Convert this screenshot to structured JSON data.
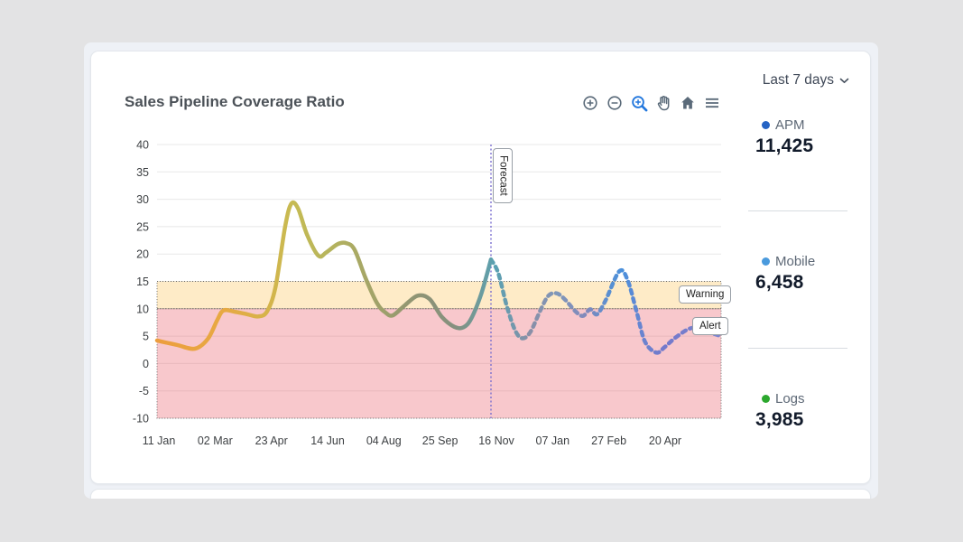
{
  "header": {
    "title": "Sales Pipeline Coverage Ratio"
  },
  "toolbar": {
    "buttons": [
      {
        "name": "zoom-in"
      },
      {
        "name": "zoom-out"
      },
      {
        "name": "box-zoom",
        "active": true
      },
      {
        "name": "pan"
      },
      {
        "name": "home"
      },
      {
        "name": "menu"
      }
    ],
    "active_color": "#2277dd",
    "icon_color": "#5a6a79"
  },
  "sidebar": {
    "range_label": "Last 7 days",
    "items": [
      {
        "label": "APM",
        "value": "11,425",
        "color": "#2563c4"
      },
      {
        "label": "Mobile",
        "value": "6,458",
        "color": "#4a9add"
      },
      {
        "label": "Logs",
        "value": "3,985",
        "color": "#2ca82e"
      }
    ]
  },
  "chart_data": {
    "type": "line",
    "title": "Sales Pipeline Coverage Ratio",
    "xlabel": "",
    "ylabel": "",
    "x_tick_labels": [
      "11 Jan",
      "02 Mar",
      "23 Apr",
      "14 Jun",
      "04 Aug",
      "25 Sep",
      "16 Nov",
      "07 Jan",
      "27 Feb",
      "20 Apr"
    ],
    "y_ticks": [
      40,
      35,
      30,
      25,
      20,
      15,
      10,
      5,
      0,
      -5,
      -10
    ],
    "ylim": [
      -10,
      40
    ],
    "grid": true,
    "legend_position": "right-panel",
    "bands": [
      {
        "name": "warning",
        "label": "Warning",
        "from": 10,
        "to": 15,
        "fill": "rgba(252,208,122,0.42)",
        "border": "#6b6b6b"
      },
      {
        "name": "alert",
        "label": "Alert",
        "from": -10,
        "to": 10,
        "fill": "rgba(236,98,110,0.35)",
        "border": "#6b6b6b"
      }
    ],
    "forecast_divider": {
      "label": "Forecast",
      "u": 0.592,
      "color": "#7b6fd0"
    },
    "series": [
      {
        "name": "history",
        "style": "solid",
        "points": [
          [
            0,
            4.2
          ],
          [
            0.035,
            3.4
          ],
          [
            0.067,
            2.7
          ],
          [
            0.09,
            4.5
          ],
          [
            0.107,
            8.0
          ],
          [
            0.118,
            9.7
          ],
          [
            0.14,
            9.4
          ],
          [
            0.16,
            9.0
          ],
          [
            0.179,
            8.6
          ],
          [
            0.195,
            9.5
          ],
          [
            0.21,
            14.0
          ],
          [
            0.227,
            25.0
          ],
          [
            0.238,
            29.2
          ],
          [
            0.25,
            28.3
          ],
          [
            0.266,
            23.5
          ],
          [
            0.286,
            19.7
          ],
          [
            0.3,
            20.3
          ],
          [
            0.32,
            21.8
          ],
          [
            0.335,
            22.0
          ],
          [
            0.35,
            20.8
          ],
          [
            0.37,
            15.5
          ],
          [
            0.39,
            11.0
          ],
          [
            0.405,
            9.3
          ],
          [
            0.418,
            8.8
          ],
          [
            0.44,
            10.7
          ],
          [
            0.462,
            12.4
          ],
          [
            0.483,
            11.8
          ],
          [
            0.505,
            8.5
          ],
          [
            0.527,
            6.7
          ],
          [
            0.543,
            6.6
          ],
          [
            0.557,
            8.2
          ],
          [
            0.575,
            12.8
          ],
          [
            0.592,
            19.0
          ]
        ]
      },
      {
        "name": "forecast",
        "style": "dashed",
        "points": [
          [
            0.592,
            19.0
          ],
          [
            0.605,
            16.5
          ],
          [
            0.62,
            10.5
          ],
          [
            0.635,
            6.0
          ],
          [
            0.648,
            4.6
          ],
          [
            0.662,
            5.8
          ],
          [
            0.68,
            9.8
          ],
          [
            0.694,
            12.4
          ],
          [
            0.709,
            12.8
          ],
          [
            0.724,
            11.6
          ],
          [
            0.742,
            9.5
          ],
          [
            0.755,
            8.7
          ],
          [
            0.768,
            9.9
          ],
          [
            0.78,
            9.0
          ],
          [
            0.795,
            11.5
          ],
          [
            0.82,
            16.9
          ],
          [
            0.835,
            15.0
          ],
          [
            0.85,
            9.5
          ],
          [
            0.865,
            4.0
          ],
          [
            0.885,
            2.0
          ],
          [
            0.9,
            3.0
          ],
          [
            0.92,
            4.8
          ],
          [
            0.945,
            6.4
          ],
          [
            0.965,
            6.3
          ],
          [
            0.985,
            5.5
          ],
          [
            1,
            5.0
          ]
        ]
      }
    ],
    "gradient_stops": [
      [
        0,
        "#ec9e3e"
      ],
      [
        0.12,
        "#e7a943"
      ],
      [
        0.2,
        "#d4b44b"
      ],
      [
        0.24,
        "#c6bb53"
      ],
      [
        0.3,
        "#b7b55c"
      ],
      [
        0.38,
        "#a3a468"
      ],
      [
        0.46,
        "#8f9474"
      ],
      [
        0.53,
        "#85907f"
      ],
      [
        0.57,
        "#6e9b9b"
      ],
      [
        0.6,
        "#58a1b3"
      ],
      [
        0.66,
        "#8a8fa6"
      ],
      [
        0.71,
        "#7e97ba"
      ],
      [
        0.76,
        "#8289bb"
      ],
      [
        0.8,
        "#5b8fd0"
      ],
      [
        0.825,
        "#4a90dc"
      ],
      [
        0.86,
        "#6a84cf"
      ],
      [
        0.9,
        "#7479cb"
      ],
      [
        1,
        "#7b85cf"
      ]
    ],
    "grid_color": "#e8e8e8"
  }
}
